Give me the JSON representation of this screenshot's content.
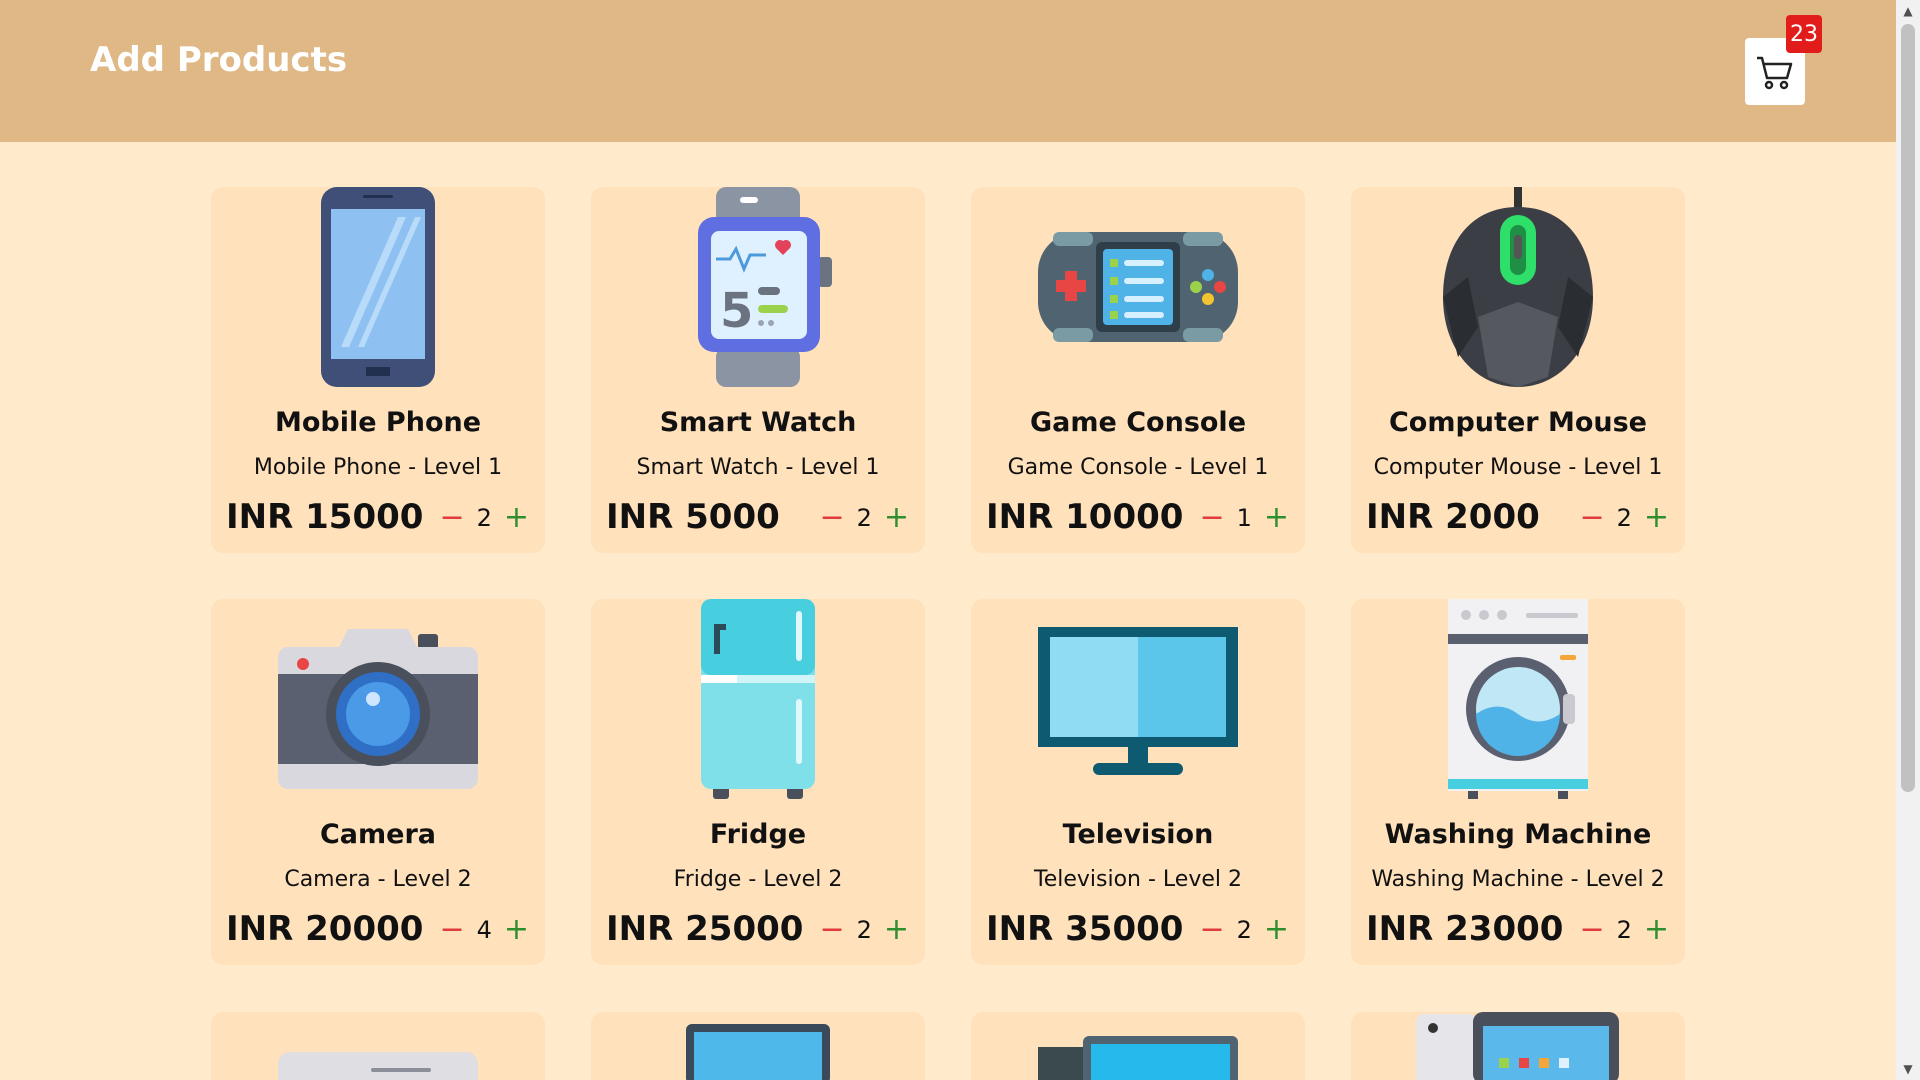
{
  "header": {
    "title": "Add Products"
  },
  "cart": {
    "count": "23",
    "icon": "cart-icon"
  },
  "products": [
    {
      "name": "Mobile Phone",
      "subtitle": "Mobile Phone - Level 1",
      "price": "INR 15000",
      "qty": "2",
      "icon": "mobile-phone-icon"
    },
    {
      "name": "Smart Watch",
      "subtitle": "Smart Watch - Level 1",
      "price": "INR 5000",
      "qty": "2",
      "icon": "smart-watch-icon"
    },
    {
      "name": "Game Console",
      "subtitle": "Game Console - Level 1",
      "price": "INR 10000",
      "qty": "1",
      "icon": "game-console-icon"
    },
    {
      "name": "Computer Mouse",
      "subtitle": "Computer Mouse - Level 1",
      "price": "INR 2000",
      "qty": "2",
      "icon": "computer-mouse-icon"
    },
    {
      "name": "Camera",
      "subtitle": "Camera - Level 2",
      "price": "INR 20000",
      "qty": "4",
      "icon": "camera-icon"
    },
    {
      "name": "Fridge",
      "subtitle": "Fridge - Level 2",
      "price": "INR 25000",
      "qty": "2",
      "icon": "fridge-icon"
    },
    {
      "name": "Television",
      "subtitle": "Television - Level 2",
      "price": "INR 35000",
      "qty": "2",
      "icon": "television-icon"
    },
    {
      "name": "Washing Machine",
      "subtitle": "Washing Machine - Level 2",
      "price": "INR 23000",
      "qty": "2",
      "icon": "washing-machine-icon"
    }
  ],
  "controls": {
    "minus": "−",
    "plus": "+"
  }
}
